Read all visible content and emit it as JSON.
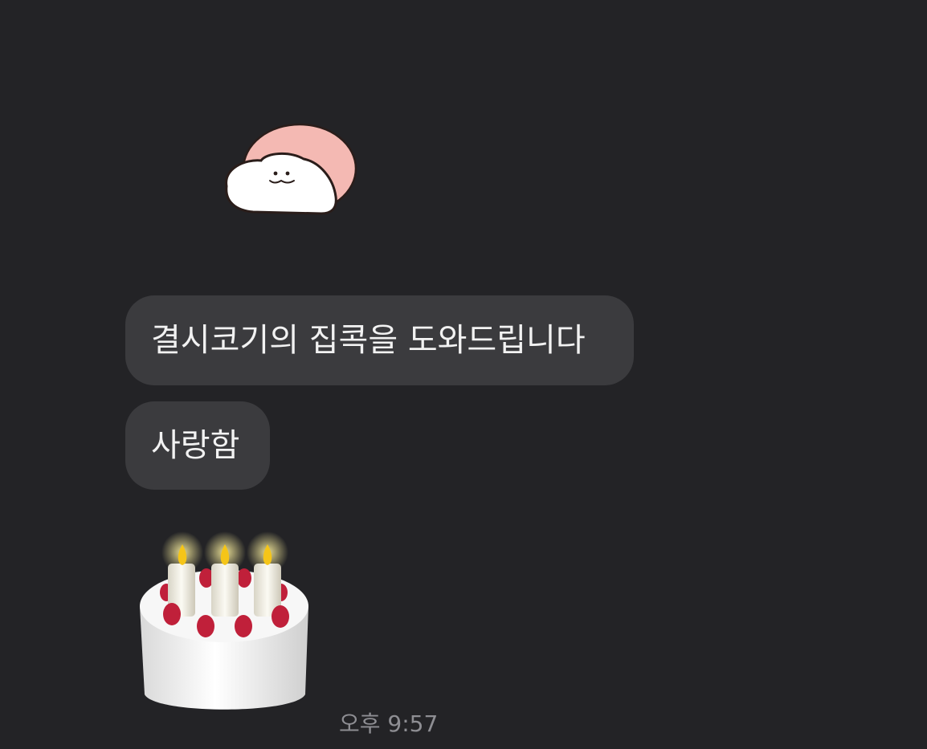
{
  "messages": [
    {
      "type": "sticker",
      "sticker": "pink-white-blob-character-sticker"
    },
    {
      "type": "text",
      "text": "결시코기의 집콕을 도와드립니다"
    },
    {
      "type": "text",
      "text": "사랑함"
    },
    {
      "type": "emoji",
      "emoji": "birthday-cake-emoji"
    }
  ],
  "timestamp": "오후 9:57",
  "colors": {
    "background": "#232326",
    "bubble": "#3b3b3e",
    "text": "#f2f2f2",
    "timestamp": "#8e8e93"
  }
}
